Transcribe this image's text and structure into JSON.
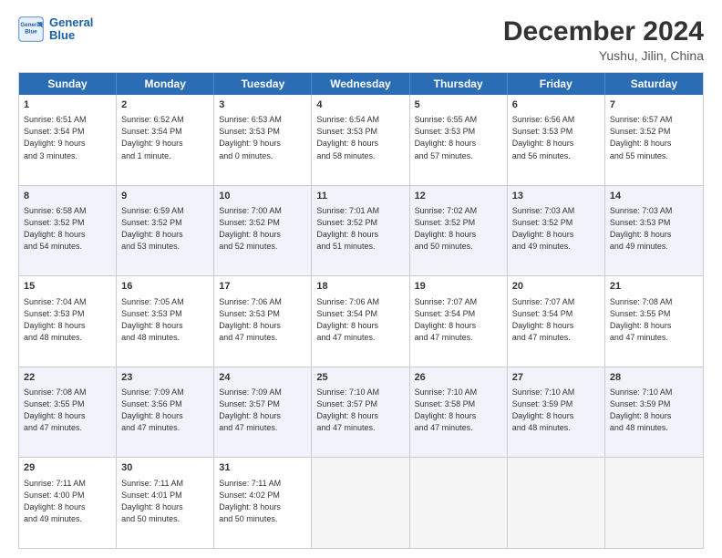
{
  "logo": {
    "line1": "General",
    "line2": "Blue"
  },
  "title": "December 2024",
  "subtitle": "Yushu, Jilin, China",
  "days_of_week": [
    "Sunday",
    "Monday",
    "Tuesday",
    "Wednesday",
    "Thursday",
    "Friday",
    "Saturday"
  ],
  "weeks": [
    [
      {
        "day": "1",
        "info": "Sunrise: 6:51 AM\nSunset: 3:54 PM\nDaylight: 9 hours\nand 3 minutes."
      },
      {
        "day": "2",
        "info": "Sunrise: 6:52 AM\nSunset: 3:54 PM\nDaylight: 9 hours\nand 1 minute."
      },
      {
        "day": "3",
        "info": "Sunrise: 6:53 AM\nSunset: 3:53 PM\nDaylight: 9 hours\nand 0 minutes."
      },
      {
        "day": "4",
        "info": "Sunrise: 6:54 AM\nSunset: 3:53 PM\nDaylight: 8 hours\nand 58 minutes."
      },
      {
        "day": "5",
        "info": "Sunrise: 6:55 AM\nSunset: 3:53 PM\nDaylight: 8 hours\nand 57 minutes."
      },
      {
        "day": "6",
        "info": "Sunrise: 6:56 AM\nSunset: 3:53 PM\nDaylight: 8 hours\nand 56 minutes."
      },
      {
        "day": "7",
        "info": "Sunrise: 6:57 AM\nSunset: 3:52 PM\nDaylight: 8 hours\nand 55 minutes."
      }
    ],
    [
      {
        "day": "8",
        "info": "Sunrise: 6:58 AM\nSunset: 3:52 PM\nDaylight: 8 hours\nand 54 minutes."
      },
      {
        "day": "9",
        "info": "Sunrise: 6:59 AM\nSunset: 3:52 PM\nDaylight: 8 hours\nand 53 minutes."
      },
      {
        "day": "10",
        "info": "Sunrise: 7:00 AM\nSunset: 3:52 PM\nDaylight: 8 hours\nand 52 minutes."
      },
      {
        "day": "11",
        "info": "Sunrise: 7:01 AM\nSunset: 3:52 PM\nDaylight: 8 hours\nand 51 minutes."
      },
      {
        "day": "12",
        "info": "Sunrise: 7:02 AM\nSunset: 3:52 PM\nDaylight: 8 hours\nand 50 minutes."
      },
      {
        "day": "13",
        "info": "Sunrise: 7:03 AM\nSunset: 3:52 PM\nDaylight: 8 hours\nand 49 minutes."
      },
      {
        "day": "14",
        "info": "Sunrise: 7:03 AM\nSunset: 3:53 PM\nDaylight: 8 hours\nand 49 minutes."
      }
    ],
    [
      {
        "day": "15",
        "info": "Sunrise: 7:04 AM\nSunset: 3:53 PM\nDaylight: 8 hours\nand 48 minutes."
      },
      {
        "day": "16",
        "info": "Sunrise: 7:05 AM\nSunset: 3:53 PM\nDaylight: 8 hours\nand 48 minutes."
      },
      {
        "day": "17",
        "info": "Sunrise: 7:06 AM\nSunset: 3:53 PM\nDaylight: 8 hours\nand 47 minutes."
      },
      {
        "day": "18",
        "info": "Sunrise: 7:06 AM\nSunset: 3:54 PM\nDaylight: 8 hours\nand 47 minutes."
      },
      {
        "day": "19",
        "info": "Sunrise: 7:07 AM\nSunset: 3:54 PM\nDaylight: 8 hours\nand 47 minutes."
      },
      {
        "day": "20",
        "info": "Sunrise: 7:07 AM\nSunset: 3:54 PM\nDaylight: 8 hours\nand 47 minutes."
      },
      {
        "day": "21",
        "info": "Sunrise: 7:08 AM\nSunset: 3:55 PM\nDaylight: 8 hours\nand 47 minutes."
      }
    ],
    [
      {
        "day": "22",
        "info": "Sunrise: 7:08 AM\nSunset: 3:55 PM\nDaylight: 8 hours\nand 47 minutes."
      },
      {
        "day": "23",
        "info": "Sunrise: 7:09 AM\nSunset: 3:56 PM\nDaylight: 8 hours\nand 47 minutes."
      },
      {
        "day": "24",
        "info": "Sunrise: 7:09 AM\nSunset: 3:57 PM\nDaylight: 8 hours\nand 47 minutes."
      },
      {
        "day": "25",
        "info": "Sunrise: 7:10 AM\nSunset: 3:57 PM\nDaylight: 8 hours\nand 47 minutes."
      },
      {
        "day": "26",
        "info": "Sunrise: 7:10 AM\nSunset: 3:58 PM\nDaylight: 8 hours\nand 47 minutes."
      },
      {
        "day": "27",
        "info": "Sunrise: 7:10 AM\nSunset: 3:59 PM\nDaylight: 8 hours\nand 48 minutes."
      },
      {
        "day": "28",
        "info": "Sunrise: 7:10 AM\nSunset: 3:59 PM\nDaylight: 8 hours\nand 48 minutes."
      }
    ],
    [
      {
        "day": "29",
        "info": "Sunrise: 7:11 AM\nSunset: 4:00 PM\nDaylight: 8 hours\nand 49 minutes."
      },
      {
        "day": "30",
        "info": "Sunrise: 7:11 AM\nSunset: 4:01 PM\nDaylight: 8 hours\nand 50 minutes."
      },
      {
        "day": "31",
        "info": "Sunrise: 7:11 AM\nSunset: 4:02 PM\nDaylight: 8 hours\nand 50 minutes."
      },
      {
        "day": "",
        "info": ""
      },
      {
        "day": "",
        "info": ""
      },
      {
        "day": "",
        "info": ""
      },
      {
        "day": "",
        "info": ""
      }
    ]
  ]
}
